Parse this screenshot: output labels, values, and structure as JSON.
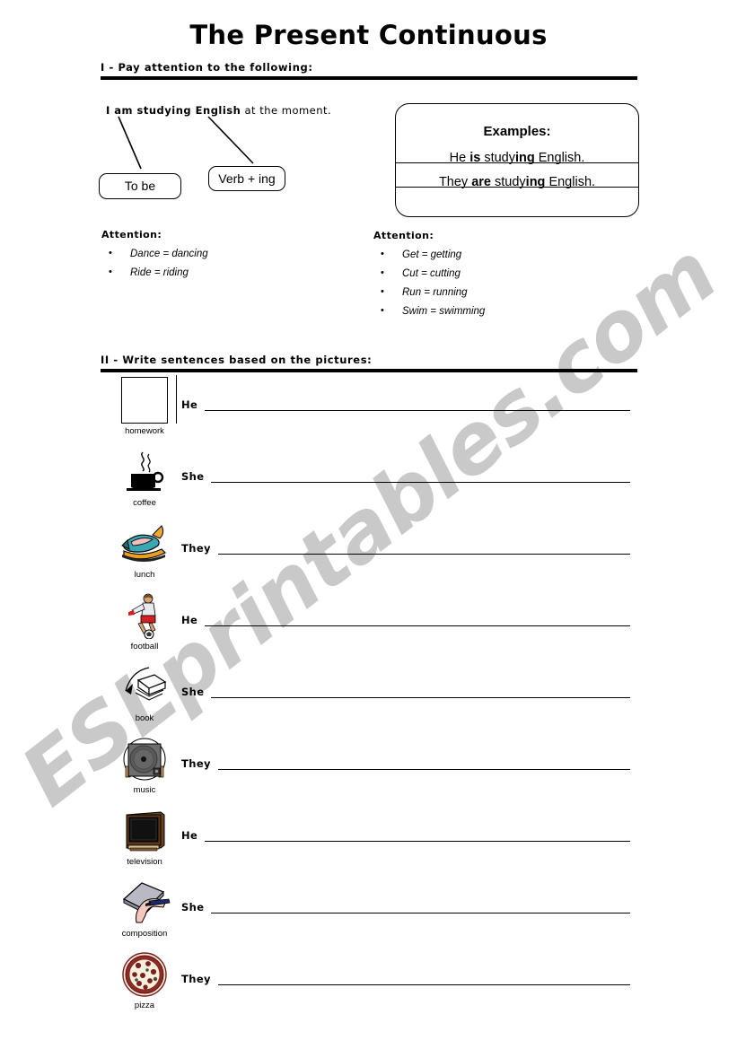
{
  "document": {
    "title": "The Present Continuous",
    "watermark": "ESLprintables.com"
  },
  "sections": [
    {
      "id": "section-1",
      "label": "I - Pay attention to the following:"
    },
    {
      "id": "section-2",
      "label": "II - Write sentences based on the pictures:"
    }
  ],
  "part1": {
    "sentence_bold": "I am studying English",
    "sentence_rest": " at the moment.",
    "tag_to_be": "To be",
    "tag_verb_ing": "Verb + ing",
    "examples": {
      "heading": "Examples:",
      "line1_a": "He ",
      "line1_b": "is",
      "line1_c": " study",
      "line1_d": "ing",
      "line1_e": " English.",
      "line2_a": "They ",
      "line2_b": "are",
      "line2_c": " study",
      "line2_d": "ing",
      "line2_e": " English."
    },
    "attention_left": {
      "title": "Attention:",
      "items": [
        "Dance = dancing",
        "Ride = riding"
      ]
    },
    "attention_right": {
      "title": "Attention:",
      "items": [
        "Get = getting",
        "Cut = cutting",
        "Run = running",
        "Swim = swimming"
      ]
    }
  },
  "part2": {
    "rows": [
      {
        "caption": "homework",
        "icon": "blank-box-icon",
        "pronoun": "He"
      },
      {
        "caption": "coffee",
        "icon": "coffee-cup-icon",
        "pronoun": "She"
      },
      {
        "caption": "lunch",
        "icon": "fish-plate-icon",
        "pronoun": "They"
      },
      {
        "caption": "football",
        "icon": "soccer-player-icon",
        "pronoun": "He"
      },
      {
        "caption": "book",
        "icon": "open-book-icon",
        "pronoun": "She"
      },
      {
        "caption": "music",
        "icon": "turntable-icon",
        "pronoun": "They"
      },
      {
        "caption": "television",
        "icon": "television-icon",
        "pronoun": "He"
      },
      {
        "caption": "composition",
        "icon": "writing-hand-icon",
        "pronoun": "She"
      },
      {
        "caption": "pizza",
        "icon": "pizza-icon",
        "pronoun": "They"
      }
    ]
  },
  "colors": {
    "ink": "#000000",
    "watermark": "#c9c9c9",
    "wood": "#8a5a2b",
    "pizza_crust": "#7b1f1f",
    "pizza_cheese": "#f5efd8"
  }
}
